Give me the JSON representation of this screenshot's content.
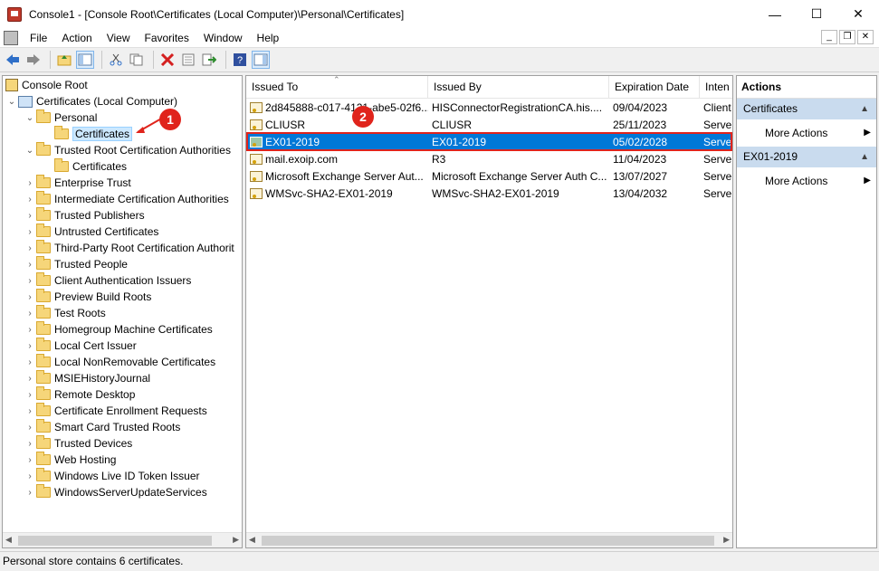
{
  "window": {
    "title": "Console1 - [Console Root\\Certificates (Local Computer)\\Personal\\Certificates]",
    "minimize_glyph": "—",
    "maximize_glyph": "☐",
    "close_glyph": "✕"
  },
  "menu": {
    "items": [
      "File",
      "Action",
      "View",
      "Favorites",
      "Window",
      "Help"
    ],
    "mdi_min": "_",
    "mdi_restore": "❐",
    "mdi_close": "✕"
  },
  "toolbar": {
    "icons": [
      "back-icon",
      "forward-icon",
      "up-folder-icon",
      "show-hide-tree-icon",
      "cut-icon",
      "copy-icon",
      "delete-icon",
      "properties-icon",
      "export-icon",
      "help-icon",
      "show-hide-action-pane-icon"
    ]
  },
  "tree": {
    "root": "Console Root",
    "certs_local": "Certificates (Local Computer)",
    "personal": "Personal",
    "personal_certs": "Certificates",
    "trusted_root": "Trusted Root Certification Authorities",
    "trusted_root_certs": "Certificates",
    "others": [
      "Enterprise Trust",
      "Intermediate Certification Authorities",
      "Trusted Publishers",
      "Untrusted Certificates",
      "Third-Party Root Certification Authorit",
      "Trusted People",
      "Client Authentication Issuers",
      "Preview Build Roots",
      "Test Roots",
      "Homegroup Machine Certificates",
      "Local Cert Issuer",
      "Local NonRemovable Certificates",
      "MSIEHistoryJournal",
      "Remote Desktop",
      "Certificate Enrollment Requests",
      "Smart Card Trusted Roots",
      "Trusted Devices",
      "Web Hosting",
      "Windows Live ID Token Issuer",
      "WindowsServerUpdateServices"
    ]
  },
  "markers": {
    "one": "1",
    "two": "2",
    "color": "#e0241c"
  },
  "list": {
    "columns": [
      "Issued To",
      "Issued By",
      "Expiration Date",
      "Inten"
    ],
    "rows": [
      [
        "2d845888-c017-4121-abe5-02f6...",
        "HISConnectorRegistrationCA.his....",
        "09/04/2023",
        "Client"
      ],
      [
        "CLIUSR",
        "CLIUSR",
        "25/11/2023",
        "Serve"
      ],
      [
        "EX01-2019",
        "EX01-2019",
        "05/02/2028",
        "Serve"
      ],
      [
        "mail.exoip.com",
        "R3",
        "11/04/2023",
        "Serve"
      ],
      [
        "Microsoft Exchange Server Aut...",
        "Microsoft Exchange Server Auth C...",
        "13/07/2027",
        "Serve"
      ],
      [
        "WMSvc-SHA2-EX01-2019",
        "WMSvc-SHA2-EX01-2019",
        "13/04/2032",
        "Serve"
      ]
    ],
    "selected_index": 2,
    "selection_color": "#0078d7"
  },
  "actions": {
    "title": "Actions",
    "section1": "Certificates",
    "section1_item": "More Actions",
    "section2": "EX01-2019",
    "section2_item": "More Actions"
  },
  "status": {
    "text": "Personal store contains 6 certificates."
  }
}
